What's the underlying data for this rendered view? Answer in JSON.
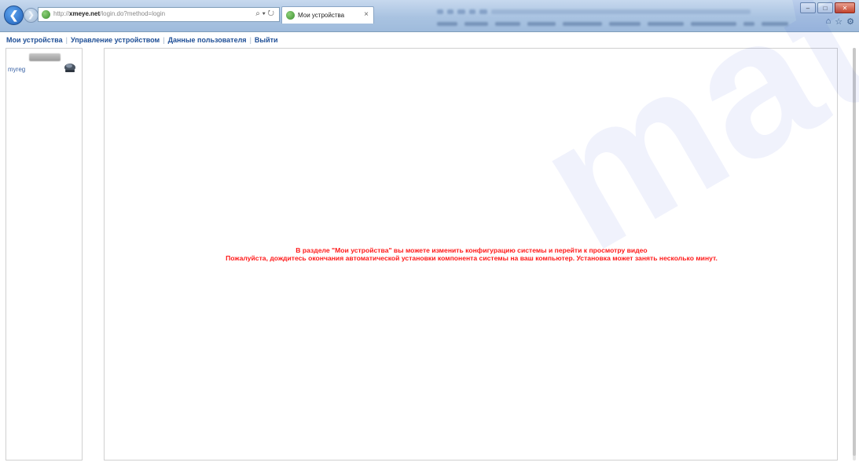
{
  "browser": {
    "url_prefix": "http://",
    "url_domain": "xmeye.net",
    "url_path": "/login.do?method=login",
    "address_tools": "⌕ ▾ ↻",
    "tab_title": "Мои устройства",
    "tab_close": "×"
  },
  "nav": {
    "items": [
      {
        "label": "Мои устройства"
      },
      {
        "label": "Управление устройством"
      },
      {
        "label": "Данные пользователя"
      },
      {
        "label": "Выйти"
      }
    ],
    "separator": "|"
  },
  "devices": [
    {
      "name": "myreg"
    }
  ],
  "message": {
    "line1": "В разделе \"Мои устройства\" вы можете изменить конфигурацию системы и перейти к просмотру видео",
    "line2": "Пожалуйста, дождитесь окончания автоматической установки компонента системы на ваш компьютер. Установка может занять несколько минут.",
    "color": "#ff1a1a"
  },
  "watermark": {
    "text": "matek"
  },
  "colors": {
    "nav_link": "#1f4f96",
    "chrome_bg": "#a9c3e1"
  }
}
